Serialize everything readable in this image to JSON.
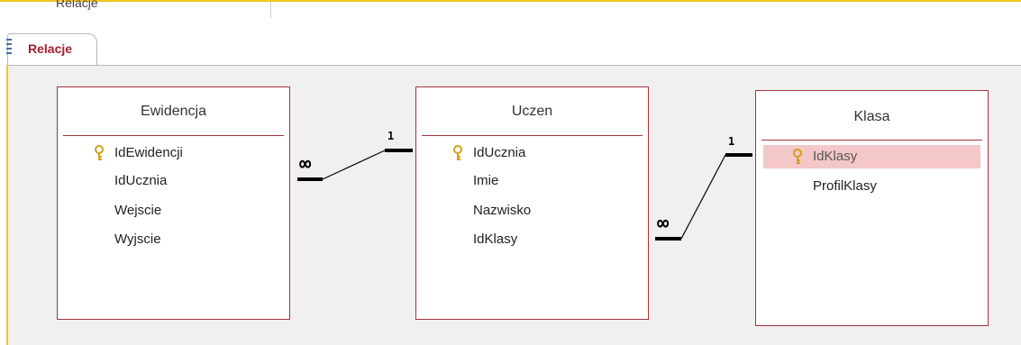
{
  "top_strip": {
    "label": "Relacje"
  },
  "tab": {
    "label": "Relacje",
    "icon": "document-grid-icon"
  },
  "tables": {
    "ewidencja": {
      "title": "Ewidencja",
      "fields": [
        "IdEwidencji",
        "IdUcznia",
        "Wejscie",
        "Wyjscie"
      ],
      "primary_key": "IdEwidencji"
    },
    "uczen": {
      "title": "Uczen",
      "fields": [
        "IdUcznia",
        "Imie",
        "Nazwisko",
        "IdKlasy"
      ],
      "primary_key": "IdUcznia"
    },
    "klasa": {
      "title": "Klasa",
      "fields": [
        "IdKlasy",
        "ProfilKlasy"
      ],
      "primary_key": "IdKlasy",
      "selected_field": "IdKlasy"
    }
  },
  "relationships": [
    {
      "from": "Ewidencja.IdUcznia",
      "to": "Uczen.IdUcznia",
      "many_label": "∞",
      "one_label": "1"
    },
    {
      "from": "Uczen.IdKlasy",
      "to": "Klasa.IdKlasy",
      "many_label": "∞",
      "one_label": "1"
    }
  ],
  "colors": {
    "accent": "#a61e2e",
    "table_border": "#a33340",
    "selection": "#f4c7c9",
    "key_icon": "#d4a017",
    "canvas": "#f0f0f0",
    "frame": "#f3c623"
  }
}
